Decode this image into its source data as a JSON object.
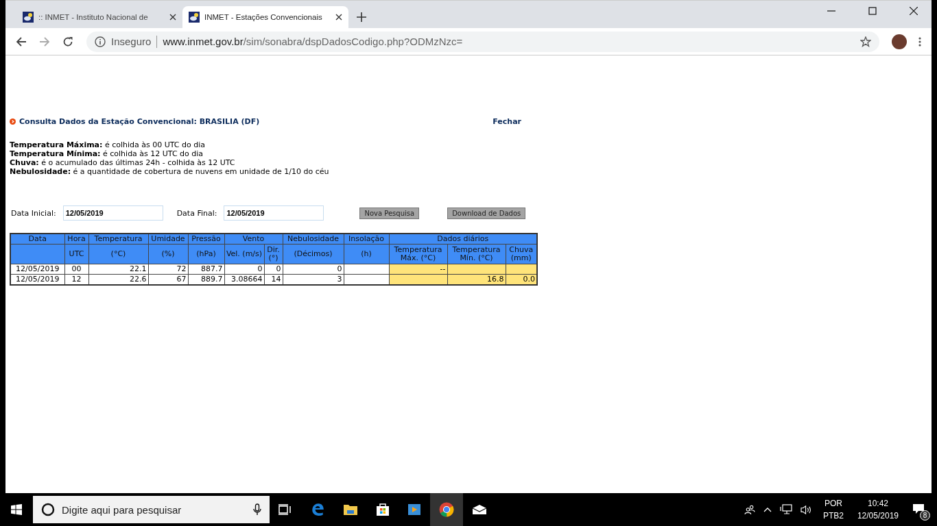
{
  "browser": {
    "tabs": [
      {
        "title": ":: INMET - Instituto Nacional de",
        "selected": false
      },
      {
        "title": "INMET - Estações Convencionais",
        "selected": true
      }
    ],
    "security": "Inseguro",
    "url_host": "www.inmet.gov.br",
    "url_path": "/sim/sonabra/dspDadosCodigo.php?ODMzNzc="
  },
  "page": {
    "title": "Consulta Dados da Estação Convencional: BRASILIA (DF)",
    "close_link": "Fechar",
    "notes": [
      {
        "term": "Temperatura Máxima:",
        "text": "é colhida às 00 UTC do dia"
      },
      {
        "term": "Temperatura Mínima:",
        "text": "é colhida às 12 UTC do dia"
      },
      {
        "term": "Chuva:",
        "text": "é o acumulado das últimas 24h - colhida às 12 UTC"
      },
      {
        "term": "Nebulosidade:",
        "text": "é a quantidade de cobertura de nuvens em unidade de 1/10 do céu"
      }
    ],
    "start_label": "Data Inicial:",
    "start_value": "12/05/2019",
    "end_label": "Data Final:",
    "end_value": "12/05/2019",
    "buttons": [
      "Nova Pesquisa",
      "Download de Dados"
    ]
  },
  "table": {
    "groups": [
      {
        "label": "Data",
        "highlighted": false
      },
      {
        "label": "Hora",
        "units": [
          "UTC"
        ],
        "highlighted": false
      },
      {
        "label": "Temperatura",
        "units": [
          "(°C)"
        ],
        "highlighted": false
      },
      {
        "label": "Umidade",
        "units": [
          "(%)"
        ],
        "highlighted": false
      },
      {
        "label": "Pressão",
        "units": [
          "(hPa)"
        ],
        "highlighted": false
      },
      {
        "label": "Vento",
        "units": [
          "Vel. (m/s)",
          "Dir. (°)"
        ],
        "highlighted": false
      },
      {
        "label": "Nebulosidade",
        "units": [
          "(Décimos)"
        ],
        "highlighted": false
      },
      {
        "label": "Insolação",
        "units": [
          "(h)"
        ],
        "highlighted": false
      },
      {
        "label": "Dados diários",
        "units": [
          "Temperatura Máx. (°C)",
          "Temperatura Mín. (°C)",
          "Chuva (mm)"
        ],
        "highlighted": true
      }
    ],
    "rows": [
      [
        "12/05/2019",
        "00",
        "22.1",
        "72",
        "887.7",
        "0",
        "0",
        "0",
        null,
        "--",
        null,
        null
      ],
      [
        "12/05/2019",
        "12",
        "22.6",
        "67",
        "889.7",
        "3.08664",
        "14",
        "3",
        null,
        null,
        "16.8",
        "0.0"
      ]
    ]
  },
  "taskbar": {
    "search_placeholder": "Digite aqui para pesquisar",
    "language": "POR",
    "layout": "PTB2",
    "time": "10:42",
    "date": "12/05/2019",
    "notifications": "8"
  }
}
